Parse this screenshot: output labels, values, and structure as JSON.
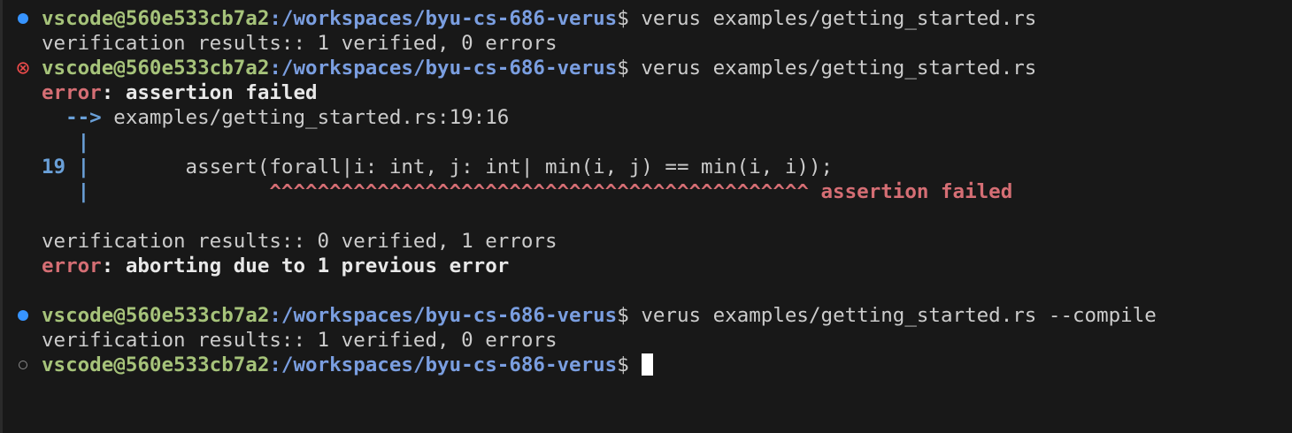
{
  "terminal": {
    "prompt_user": "vscode@560e533cb7a2",
    "prompt_path": ":/workspaces/byu-cs-686-verus",
    "prompt_symbol": "$",
    "commands": {
      "c1": "verus examples/getting_started.rs",
      "c2": "verus examples/getting_started.rs",
      "c3": "verus examples/getting_started.rs --compile"
    },
    "outputs": {
      "result1": "verification results:: 1 verified, 0 errors",
      "error_word": "error",
      "error_msg1": ": assertion failed",
      "location_arrow": "-->",
      "location": " examples/getting_started.rs:19:16",
      "gutter_pipe": "|",
      "line_number": "19",
      "source_line": "        assert(forall|i: int, j: int| min(i, j) == min(i, i));",
      "carets": "^^^^^^^^^^^^^^^^^^^^^^^^^^^^^^^^^^^^^^^^^^^^^",
      "caret_label": " assertion failed",
      "result2": "verification results:: 0 verified, 1 errors",
      "error_word2": "error",
      "error_msg2": ": aborting due to 1 previous error",
      "result3": "verification results:: 1 verified, 0 errors"
    },
    "colors": {
      "background": "#181818",
      "user": "#a6c37a",
      "path": "#7a9ee0",
      "error": "#d56e74",
      "success_dot": "#3794ff",
      "error_icon": "#f14c4c"
    }
  }
}
